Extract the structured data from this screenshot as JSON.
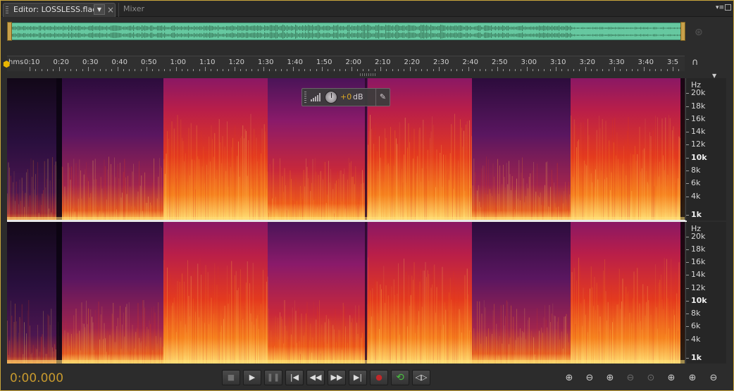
{
  "tabs": {
    "editor_label": "Editor: LOSSLESS.flac",
    "mixer_label": "Mixer",
    "dropdown_icon": "chevron-down-icon",
    "close_icon": "close-icon"
  },
  "ruler": {
    "labels": [
      "hms",
      "0:10",
      "0:20",
      "0:30",
      "0:40",
      "0:50",
      "1:00",
      "1:10",
      "1:20",
      "1:30",
      "1:40",
      "1:50",
      "2:00",
      "2:10",
      "2:20",
      "2:30",
      "2:40",
      "2:50",
      "3:00",
      "3:10",
      "3:20",
      "3:30",
      "3:40",
      "3:5"
    ]
  },
  "hud": {
    "value": "+0",
    "unit": "dB"
  },
  "freq_axis": {
    "unit": "Hz",
    "labels": [
      "20k",
      "18k",
      "16k",
      "14k",
      "12k",
      "10k",
      "8k",
      "6k",
      "4k",
      "1k"
    ]
  },
  "status": {
    "timecode": "0:00.000"
  },
  "transport": [
    {
      "name": "stop-button",
      "glyph": "■",
      "dim": true
    },
    {
      "name": "play-button",
      "glyph": "▶",
      "dim": false
    },
    {
      "name": "pause-button",
      "glyph": "❚❚",
      "dim": true
    },
    {
      "name": "go-to-start-button",
      "glyph": "|◀",
      "dim": false
    },
    {
      "name": "rewind-button",
      "glyph": "◀◀",
      "dim": false
    },
    {
      "name": "fast-forward-button",
      "glyph": "▶▶",
      "dim": false
    },
    {
      "name": "go-to-end-button",
      "glyph": "▶|",
      "dim": false
    },
    {
      "name": "record-button",
      "glyph": "●",
      "dim": false
    },
    {
      "name": "loop-button",
      "glyph": "⟲",
      "dim": false
    },
    {
      "name": "skip-selection-button",
      "glyph": "◁▷",
      "dim": false
    }
  ],
  "zoom_tools": [
    {
      "name": "zoom-in-amplitude-button",
      "glyph": "⊕",
      "dim": false
    },
    {
      "name": "zoom-out-amplitude-button",
      "glyph": "⊖",
      "dim": false
    },
    {
      "name": "zoom-in-time-button",
      "glyph": "⊕",
      "dim": false
    },
    {
      "name": "zoom-out-time-button",
      "glyph": "⊖",
      "dim": true
    },
    {
      "name": "zoom-to-selection-button",
      "glyph": "⊙",
      "dim": true
    },
    {
      "name": "zoom-in-left-button",
      "glyph": "⊕",
      "dim": false
    },
    {
      "name": "zoom-in-right-button",
      "glyph": "⊕",
      "dim": false
    },
    {
      "name": "zoom-out-full-button",
      "glyph": "⊖",
      "dim": false
    }
  ],
  "colors": {
    "accent": "#c89a2e",
    "overview_wave": "#66c8a0",
    "spectrogram_low": "#1a0a2a",
    "spectrogram_mid": "#8a1a6a",
    "spectrogram_high": "#e63a1a",
    "spectrogram_peak": "#ffe070"
  }
}
